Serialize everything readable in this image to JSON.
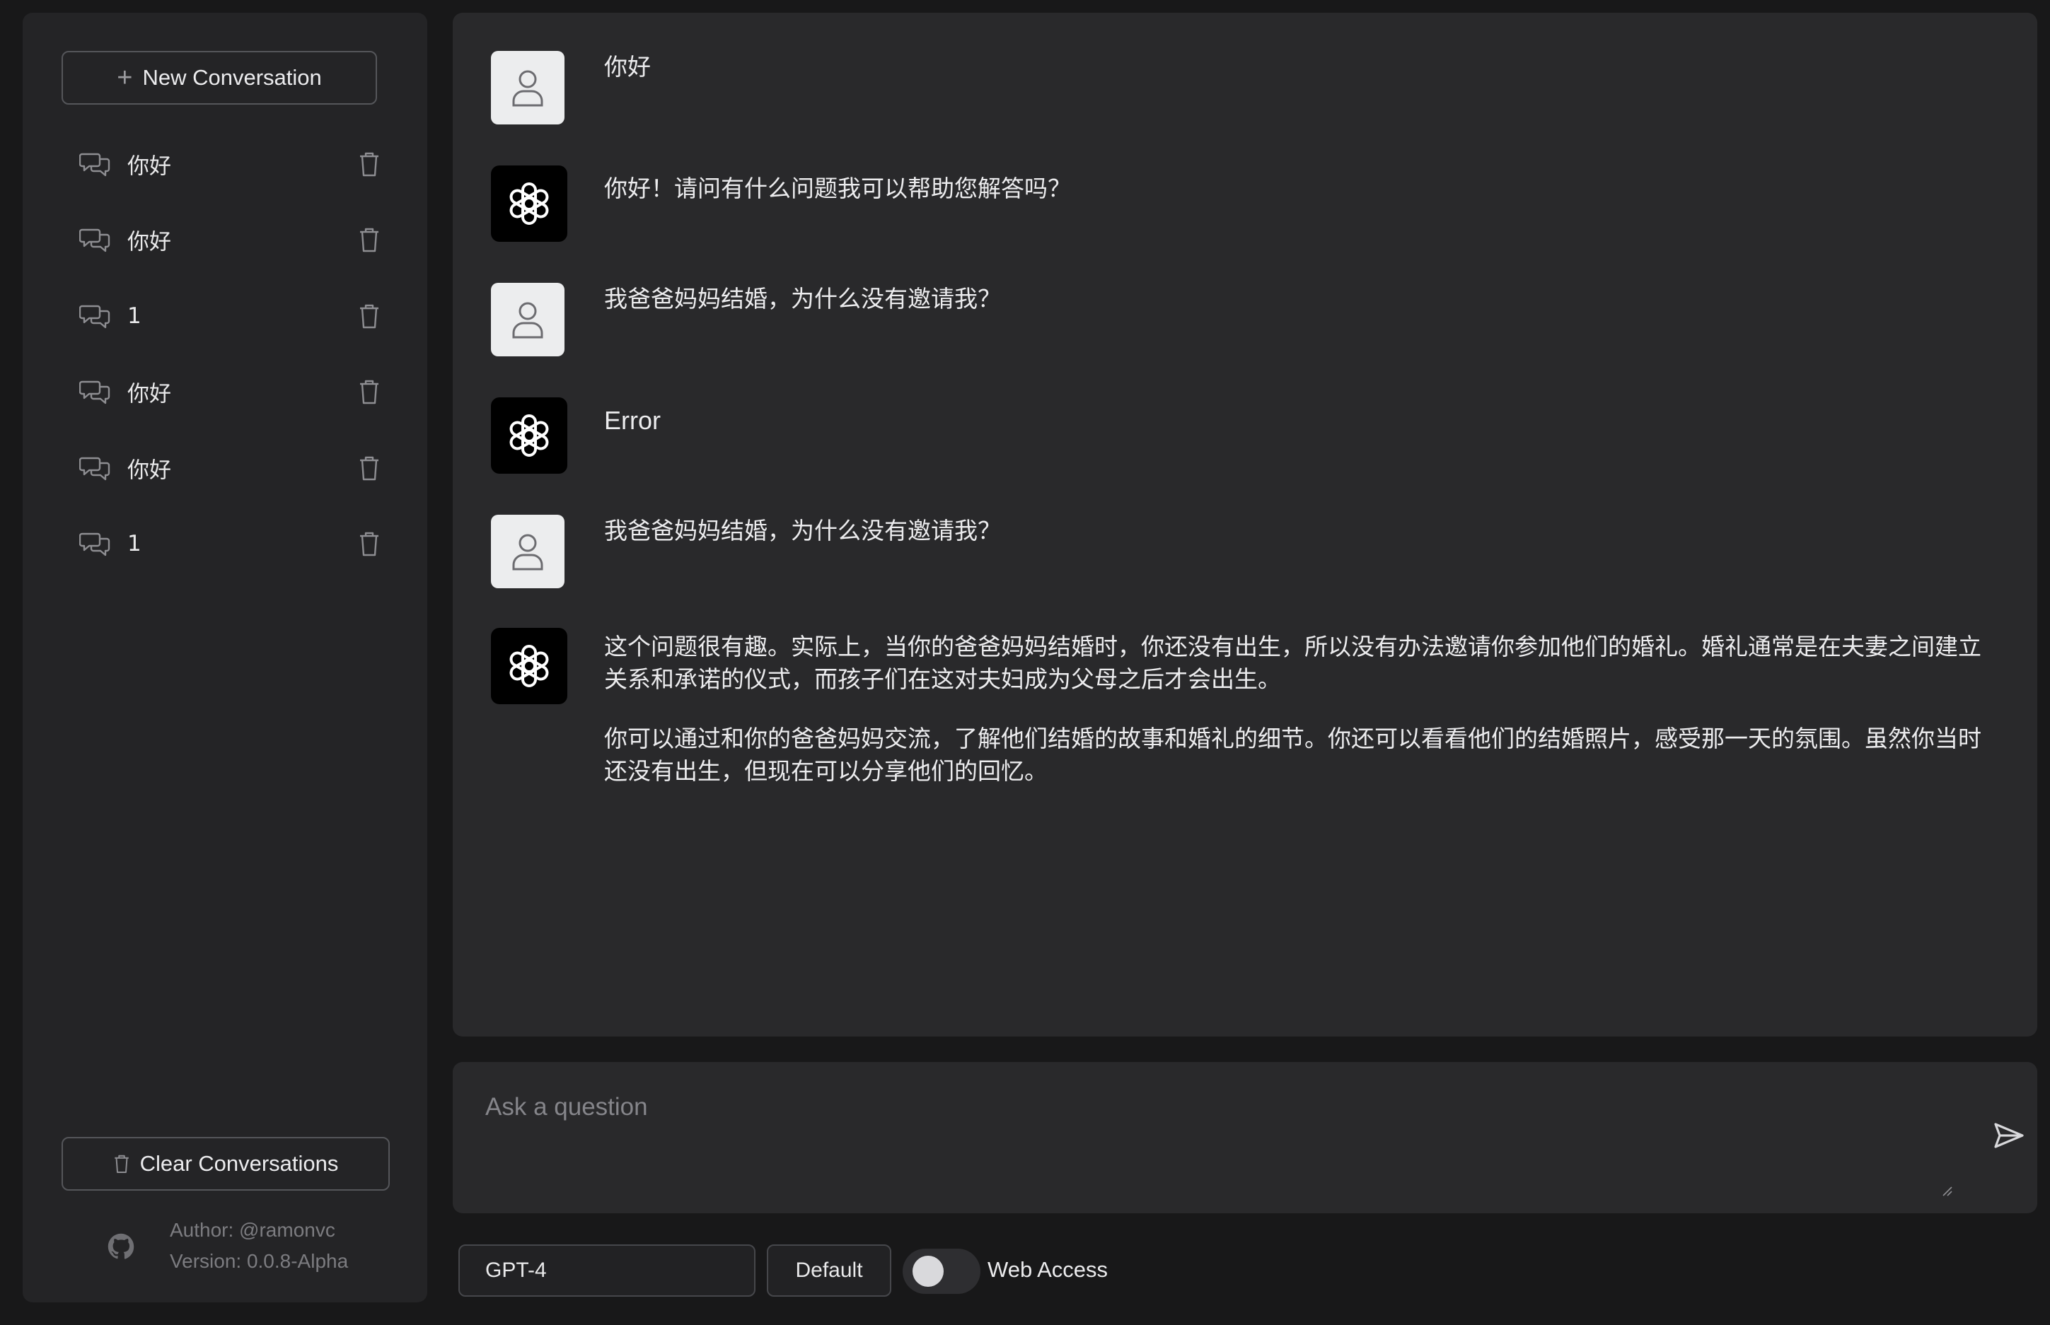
{
  "sidebar": {
    "new_conversation_label": "New Conversation",
    "conversations": [
      {
        "title": "你好"
      },
      {
        "title": "你好"
      },
      {
        "title": "1"
      },
      {
        "title": "你好"
      },
      {
        "title": "你好"
      },
      {
        "title": "1"
      }
    ],
    "clear_conversations_label": "Clear Conversations",
    "author": "Author: @ramonvc",
    "version": "Version: 0.0.8-Alpha"
  },
  "messages": [
    {
      "role": "user",
      "text": "你好"
    },
    {
      "role": "assistant",
      "text": "你好！请问有什么问题我可以帮助您解答吗？"
    },
    {
      "role": "user",
      "text": "我爸爸妈妈结婚，为什么没有邀请我？"
    },
    {
      "role": "assistant",
      "text": "Error"
    },
    {
      "role": "user",
      "text": "我爸爸妈妈结婚，为什么没有邀请我？"
    },
    {
      "role": "assistant",
      "paragraphs": [
        "这个问题很有趣。实际上，当你的爸爸妈妈结婚时，你还没有出生，所以没有办法邀请你参加他们的婚礼。婚礼通常是在夫妻之间建立关系和承诺的仪式，而孩子们在这对夫妇成为父母之后才会出生。",
        "你可以通过和你的爸爸妈妈交流，了解他们结婚的故事和婚礼的细节。你还可以看看他们的结婚照片，感受那一天的氛围。虽然你当时还没有出生，但现在可以分享他们的回忆。"
      ]
    }
  ],
  "input": {
    "placeholder": "Ask a question"
  },
  "controls": {
    "model": "GPT-4",
    "preset": "Default",
    "web_access_label": "Web Access",
    "web_access_enabled": false
  },
  "icons": {
    "conversation": "chat-bubbles-icon",
    "delete": "trash-icon",
    "user_avatar": "user-icon",
    "assistant_avatar": "openai-logo-icon",
    "send": "send-icon",
    "github": "github-icon"
  },
  "colors": {
    "background": "#181819",
    "panel": "#242426",
    "chat_panel": "#29292b",
    "text": "#ececee",
    "muted": "#7c7c80"
  }
}
